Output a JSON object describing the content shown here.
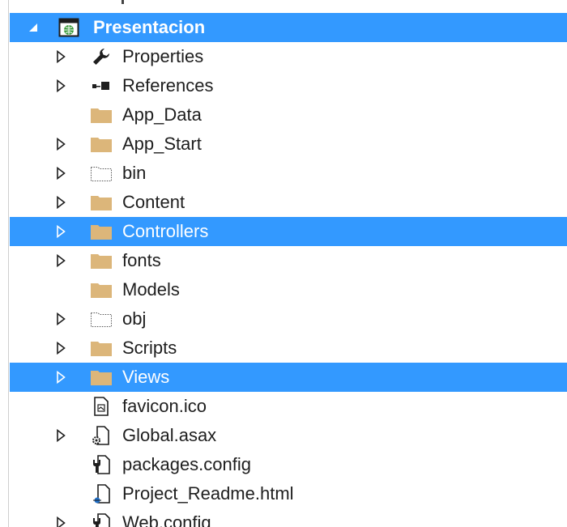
{
  "colors": {
    "selection": "#3399ff",
    "folder": "#dcb67a",
    "text": "#1e1e1e"
  },
  "tree": {
    "root": {
      "label": "Presentacion",
      "icon": "web-project-icon",
      "expander": "collapse-triangle-icon"
    },
    "items": [
      {
        "label": "Properties",
        "icon": "wrench-icon",
        "expandable": true
      },
      {
        "label": "References",
        "icon": "references-icon",
        "expandable": true
      },
      {
        "label": "App_Data",
        "icon": "folder-icon",
        "expandable": false
      },
      {
        "label": "App_Start",
        "icon": "folder-icon",
        "expandable": true
      },
      {
        "label": "bin",
        "icon": "dotted-folder-icon",
        "expandable": true
      },
      {
        "label": "Content",
        "icon": "folder-icon",
        "expandable": true
      },
      {
        "label": "Controllers",
        "icon": "folder-icon",
        "expandable": true,
        "selected": true
      },
      {
        "label": "fonts",
        "icon": "folder-icon",
        "expandable": true
      },
      {
        "label": "Models",
        "icon": "folder-icon",
        "expandable": false
      },
      {
        "label": "obj",
        "icon": "dotted-folder-icon",
        "expandable": true
      },
      {
        "label": "Scripts",
        "icon": "folder-icon",
        "expandable": true
      },
      {
        "label": "Views",
        "icon": "folder-icon",
        "expandable": true,
        "selected": true
      },
      {
        "label": "favicon.ico",
        "icon": "image-file-icon",
        "expandable": false
      },
      {
        "label": "Global.asax",
        "icon": "asax-file-icon",
        "expandable": true
      },
      {
        "label": "packages.config",
        "icon": "config-file-icon",
        "expandable": false
      },
      {
        "label": "Project_Readme.html",
        "icon": "html-file-icon",
        "expandable": false
      },
      {
        "label": "Web.config",
        "icon": "config-file-icon",
        "expandable": true
      }
    ]
  }
}
